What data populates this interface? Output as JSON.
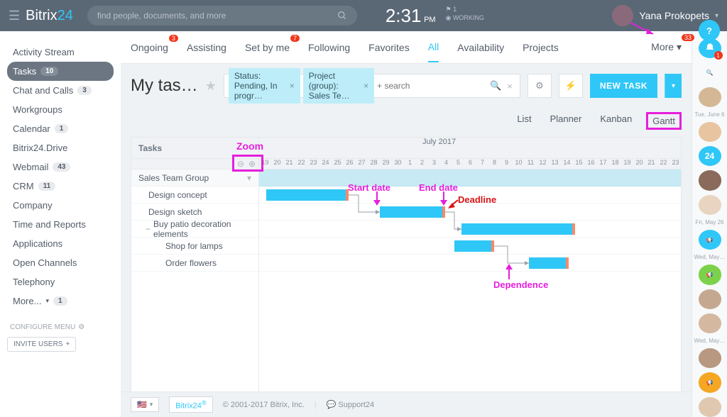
{
  "brand": {
    "name": "Bitrix",
    "accent": "24"
  },
  "search": {
    "placeholder": "find people, documents, and more"
  },
  "clock": {
    "time": "2:31",
    "ampm": "PM",
    "count": "1",
    "status": "WORKING"
  },
  "user": {
    "name": "Yana Prokopets"
  },
  "help": {
    "label": "?"
  },
  "leftnav": {
    "items": [
      {
        "label": "Activity Stream"
      },
      {
        "label": "Tasks",
        "badge": "10",
        "active": true
      },
      {
        "label": "Chat and Calls",
        "badge": "3"
      },
      {
        "label": "Workgroups"
      },
      {
        "label": "Calendar",
        "badge": "1"
      },
      {
        "label": "Bitrix24.Drive"
      },
      {
        "label": "Webmail",
        "badge": "43"
      },
      {
        "label": "CRM",
        "badge": "11"
      },
      {
        "label": "Company"
      },
      {
        "label": "Time and Reports"
      },
      {
        "label": "Applications"
      },
      {
        "label": "Open Channels"
      },
      {
        "label": "Telephony"
      },
      {
        "label": "More...",
        "badge": "1",
        "caret": true
      }
    ],
    "configure": "CONFIGURE MENU",
    "invite": "INVITE USERS"
  },
  "subtabs": {
    "items": [
      {
        "label": "Ongoing",
        "count": "3"
      },
      {
        "label": "Assisting"
      },
      {
        "label": "Set by me",
        "count": "7"
      },
      {
        "label": "Following"
      },
      {
        "label": "Favorites"
      },
      {
        "label": "All",
        "active": true
      },
      {
        "label": "Availability"
      },
      {
        "label": "Projects"
      }
    ],
    "more": {
      "label": "More",
      "count": "33"
    }
  },
  "titlerow": {
    "title": "My tas…",
    "chip1": "Status: Pending, In progr…",
    "chip2": "Project (group): Sales Te…",
    "search_placeholder": "+ search",
    "newtask": "NEW TASK"
  },
  "viewswitch": {
    "list": "List",
    "planner": "Planner",
    "kanban": "Kanban",
    "gantt": "Gantt"
  },
  "gantt": {
    "tasks_header": "Tasks",
    "month": "July 2017",
    "days": [
      "19",
      "20",
      "21",
      "22",
      "23",
      "24",
      "25",
      "26",
      "27",
      "28",
      "29",
      "30",
      "1",
      "2",
      "3",
      "4",
      "5",
      "6",
      "7",
      "8",
      "9",
      "10",
      "11",
      "12",
      "13",
      "14",
      "15",
      "16",
      "17",
      "18",
      "19",
      "20",
      "21",
      "22",
      "23"
    ],
    "group": "Sales Team Group",
    "rows": [
      {
        "label": "Design concept"
      },
      {
        "label": "Design sketch"
      },
      {
        "label": "Buy patio decoration elements",
        "collapsible": true
      },
      {
        "label": "Shop for lamps",
        "sub": true
      },
      {
        "label": "Order flowers",
        "sub": true
      }
    ]
  },
  "annotations": {
    "zoom": "Zoom",
    "start": "Start date",
    "end": "End date",
    "deadline": "Deadline",
    "dep": "Dependence"
  },
  "rightrail": {
    "notif_count": "1",
    "dates": [
      "Tue, June 6",
      "Fri, May 26",
      "Wed, May…",
      "Wed, May…"
    ]
  },
  "footer": {
    "powered": "Bitrix24",
    "copyright": "© 2001-2017 Bitrix, Inc.",
    "support": "Support24"
  }
}
